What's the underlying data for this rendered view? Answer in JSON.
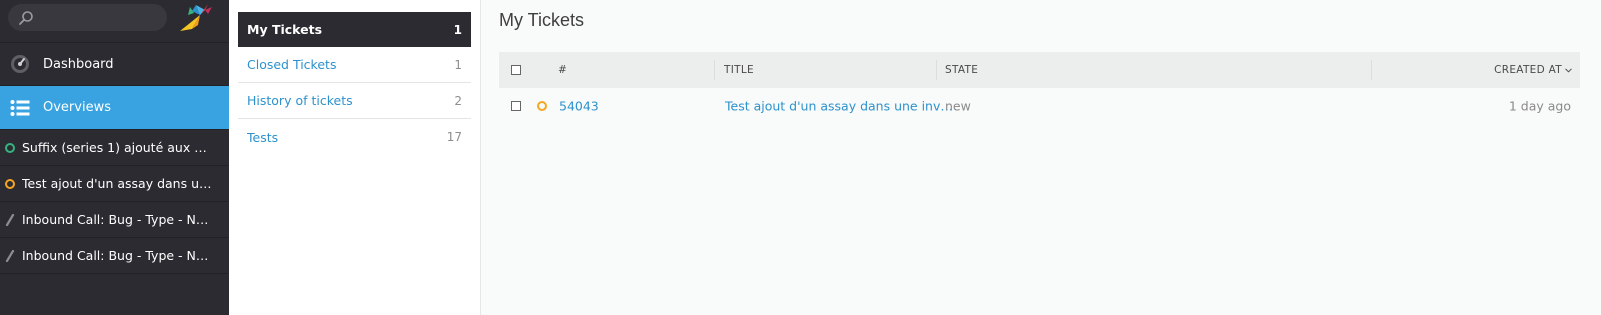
{
  "nav": {
    "search": {
      "placeholder": ""
    },
    "main_items": [
      {
        "label": "Dashboard",
        "icon": "dashboard-icon"
      },
      {
        "label": "Overviews",
        "icon": "list-icon"
      }
    ],
    "tasks": [
      {
        "label": "Suffix (series 1) ajouté aux nom…",
        "icon": "ring-icon",
        "color": "#36b37e"
      },
      {
        "label": "Test ajout d'un assay dans une i…",
        "icon": "ring-icon",
        "color": "#f5a623"
      },
      {
        "label": "Inbound Call: Bug - Type - Name",
        "icon": "pencil-icon"
      },
      {
        "label": "Inbound Call: Bug - Type - Name",
        "icon": "pencil-icon"
      }
    ]
  },
  "overviews": [
    {
      "label": "My Tickets",
      "count": "1"
    },
    {
      "label": "Closed Tickets",
      "count": "1"
    },
    {
      "label": "History of tickets",
      "count": "2"
    },
    {
      "label": "Tests",
      "count": "17"
    }
  ],
  "main": {
    "title": "My Tickets",
    "columns": {
      "number": "#",
      "title": "TITLE",
      "state": "STATE",
      "created_at": "CREATED AT"
    },
    "rows": [
      {
        "number": "54043",
        "title": "Test ajout d'un assay dans une inv…",
        "state": "new",
        "created_at": "1 day ago",
        "status_color": "#f5a623"
      }
    ]
  },
  "colors": {
    "nav_bg": "#2b2b31",
    "accent": "#38a3e0",
    "link": "#2d92cc"
  }
}
